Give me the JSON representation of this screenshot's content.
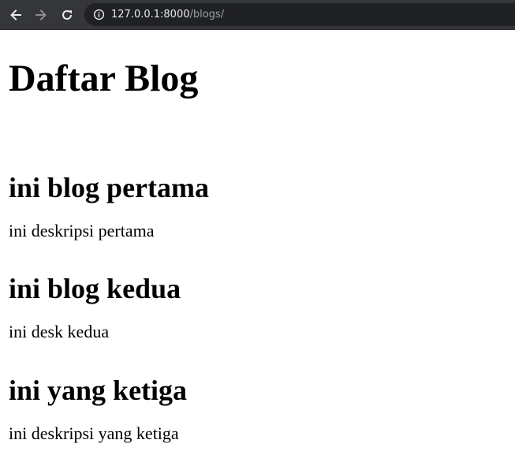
{
  "browser": {
    "url_host": "127.0.0.1:8000",
    "url_path": "/blogs/"
  },
  "page": {
    "title": "Daftar Blog"
  },
  "blogs": [
    {
      "title": "ini blog pertama",
      "description": "ini deskripsi pertama"
    },
    {
      "title": "ini blog kedua",
      "description": "ini desk kedua"
    },
    {
      "title": "ini yang ketiga",
      "description": "ini deskripsi yang ketiga"
    }
  ],
  "colors": {
    "toolbar_bg": "#35363a",
    "omnibox_bg": "#202124",
    "page_bg": "#ffffff",
    "text": "#000000"
  },
  "icons": [
    "back-arrow-icon",
    "forward-arrow-icon",
    "reload-icon",
    "info-icon"
  ]
}
